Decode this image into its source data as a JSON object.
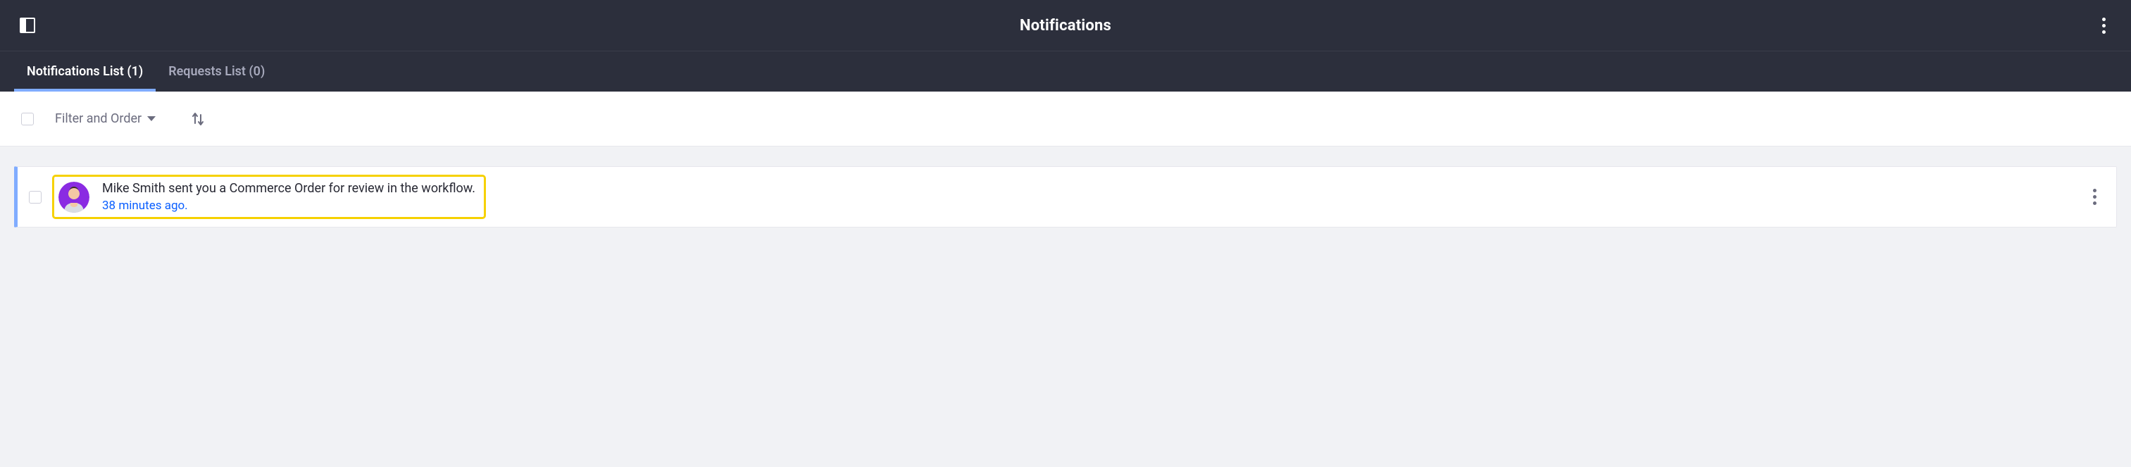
{
  "header": {
    "title": "Notifications"
  },
  "tabs": [
    {
      "label": "Notifications List (1)",
      "active": true
    },
    {
      "label": "Requests List (0)",
      "active": false
    }
  ],
  "toolbar": {
    "filter_label": "Filter and Order"
  },
  "notifications": [
    {
      "message": "Mike Smith sent you a Commerce Order for review in the workflow.",
      "time": "38 minutes ago.",
      "avatar_bg": "#8a2be2"
    }
  ],
  "colors": {
    "header_bg": "#2c2f3c",
    "accent": "#80acff",
    "link": "#0b5fff",
    "highlight": "#f6d100"
  }
}
